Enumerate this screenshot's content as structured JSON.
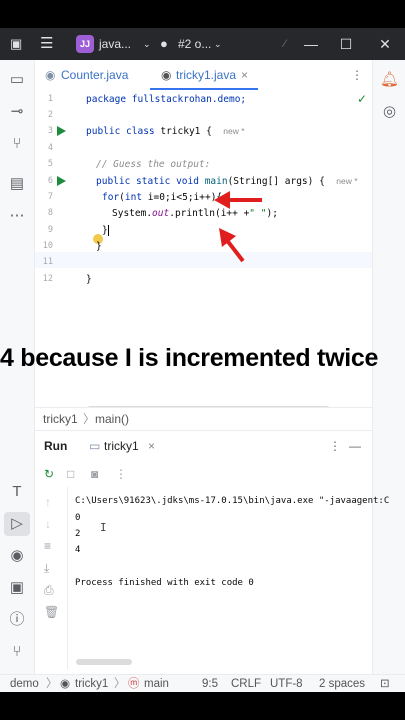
{
  "titlebar": {
    "project_badge": "JJ",
    "project_name": "java...",
    "vcs_label": "#2 o...",
    "minimize": "—",
    "maximize": "☐",
    "close": "✕"
  },
  "tabs": [
    {
      "label": "Counter.java",
      "active": false
    },
    {
      "label": "tricky1.java",
      "active": true
    }
  ],
  "code": {
    "line1": "package fullstackrohan.demo;",
    "line3_kw": "public class",
    "line3_rest": " tricky1 {",
    "line3_hint": "new *",
    "line5": "// Guess the output:",
    "line6_kw": "public static void",
    "line6_fn": "main",
    "line6_rest": "(String[] args) {",
    "line6_hint": "new *",
    "line7_kw": "for",
    "line7_int": "int",
    "line7_rest": " i=0;i<5;i++){",
    "line8_a": "System.",
    "line8_out": "out",
    "line8_b": ".println(i++ +",
    "line8_str": "\" \"",
    "line8_c": ");",
    "line9": "}",
    "line10": "}",
    "line12": "}",
    "line_numbers": [
      "1",
      "2",
      "3",
      "4",
      "5",
      "6",
      "7",
      "8",
      "9",
      "10",
      "11",
      "12"
    ]
  },
  "breadcrumb": {
    "class_name": "tricky1",
    "method": "main()"
  },
  "run_panel": {
    "title": "Run",
    "tab_label": "tricky1",
    "command": "C:\\Users\\91623\\.jdks\\ms-17.0.15\\bin\\java.exe \"-javaagent:C",
    "output": [
      "0",
      "2",
      "4"
    ],
    "finished": "Process finished with exit code 0"
  },
  "statusbar": {
    "project": "demo",
    "file": "tricky1",
    "member": "main",
    "position": "9:5",
    "line_sep": "CRLF",
    "encoding": "UTF-8",
    "indent": "2 spaces"
  },
  "overlay": {
    "caption": "4 because I is incremented twice"
  },
  "colors": {
    "accent": "#3574f0",
    "arrow": "#e01e1e",
    "run": "#208a3c"
  }
}
